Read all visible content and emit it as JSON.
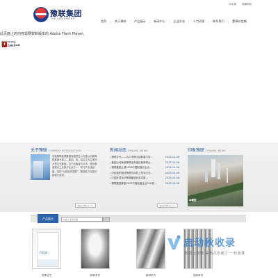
{
  "header": {
    "logo_cn": "豫联集团",
    "logo_en": "YULIAN GROUP",
    "top_links": [
      "中文版",
      "收藏网站"
    ],
    "nav": [
      "首页",
      "关于豫联",
      "产品展示",
      "新闻中心",
      "企业文化",
      "人力资源",
      "联系我们",
      "董事长信箱"
    ]
  },
  "banner": {
    "flash_message": "此页面上的内容需要较新版本的 Adobe Flash Player。",
    "badge_line1": "GET ADOBE",
    "badge_line2": "FLASH PLAYER",
    "badge_icon": "f"
  },
  "about": {
    "title": "关于豫联",
    "subtitle": "COMPANY INTRODUCTION",
    "text": "河南豫联能源集团有限责任公司是以河南豫联集团为核心，集铝、电、铝加工为主体的大型企业集团，位于河南省巩义市，是河南省重点工业骨干企业之一，实行产业化经营，坚持“以质量求发展”，集团实力位居中国铝业百强。",
    "readmore": "Read More >>"
  },
  "news": {
    "title": "新闻动态",
    "subtitle": "DYNAMIC NEWS",
    "items": [
      {
        "title": "豫联中州——巩义市豫中迎新春平安...",
        "date": "2023-10-08"
      },
      {
        "title": "集团公司荣获豫联征和谐信用荣誉企...",
        "date": "2023-10-08"
      },
      {
        "title": "豫联集团上榜2023中国制造业企业...",
        "date": "2023-10-06"
      },
      {
        "title": "中铝洛阳铜业豫联全体员工签字仪式...",
        "date": "2023-10-06"
      },
      {
        "title": "中国环境标识豫联集团业务发展...",
        "date": "2023-10-06"
      },
      {
        "title": "豫联集团荣登2023中国民营企业500强...",
        "date": "2023-10-06"
      }
    ],
    "readmore": "Read More >>"
  },
  "impress": {
    "title": "印象豫联",
    "subtitle": "DYNAMIC NEWS",
    "caption": "本期图"
  },
  "products": {
    "tab": "产品展示",
    "search_placeholder": "请输入查找内容",
    "items": [
      "资质证书",
      "铝材系列",
      "铝材系列",
      "铝材系列"
    ]
  },
  "watermark": {
    "title": "启动秋收录",
    "subtitle": "收录上线慢·等到花也谢了·一秒收录"
  }
}
